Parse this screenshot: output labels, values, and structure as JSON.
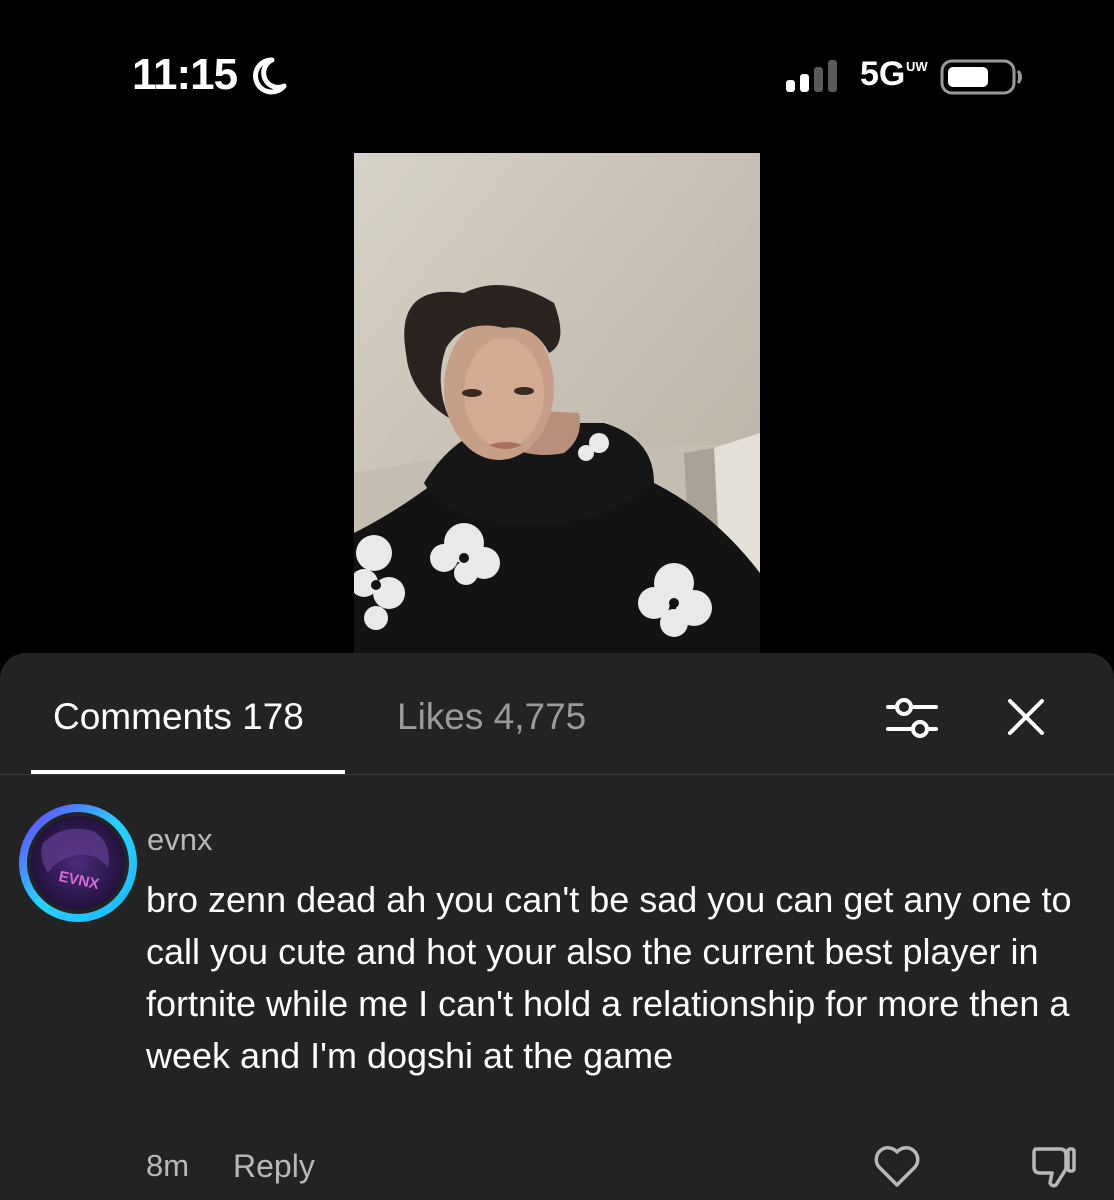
{
  "status_bar": {
    "time": "11:15",
    "network": "5G",
    "network_sub": "UW",
    "icons": [
      "moon-icon",
      "signal-bars-icon",
      "battery-icon"
    ]
  },
  "video": {
    "description_icon": "live-video-preview"
  },
  "sheet": {
    "tabs": [
      {
        "label": "Comments 178",
        "active": true
      },
      {
        "label": "Likes 4,775",
        "active": false
      }
    ],
    "icons": [
      "filter-icon",
      "close-icon"
    ]
  },
  "comment": {
    "username": "evnx",
    "avatar_text": "EVNX",
    "text": "bro zenn dead ah you can't be sad you can get any one to call you cute and hot your also the current best player in fortnite while me I can't hold a relationship for more then a week and I'm dogshi at the game",
    "time": "8m",
    "reply_label": "Reply",
    "icons": [
      "heart-icon",
      "dislike-icon"
    ]
  },
  "colors": {
    "background": "#000000",
    "sheet": "#232323",
    "muted_text": "#9a9a9a",
    "avatar_ring_start": "#27d3ff",
    "avatar_ring_end": "#6a3cff"
  }
}
